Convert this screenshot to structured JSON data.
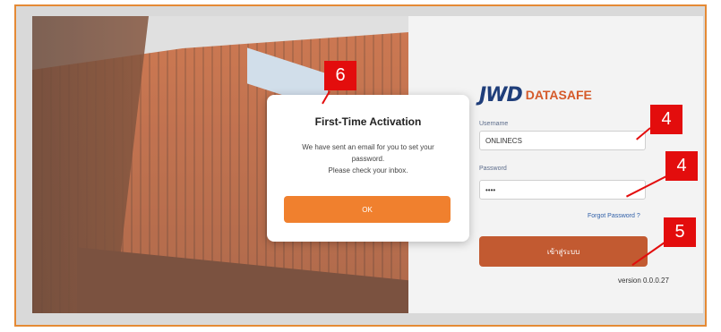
{
  "brand": {
    "mark": "JWD",
    "word": "DATASAFE"
  },
  "form": {
    "username_label": "Username",
    "username_value": "ONLINECS",
    "password_label": "Password",
    "password_value": "••••",
    "forgot_label": "Forgot Password ?",
    "login_label": "เข้าสู่ระบบ",
    "version": "version 0.0.0.27"
  },
  "modal": {
    "title": "First-Time Activation",
    "line1": "We have sent an email for you to set your",
    "line2": "password.",
    "line3": "Please check your inbox.",
    "ok_label": "OK"
  },
  "annotations": {
    "callout_6": "6",
    "callout_4a": "4",
    "callout_4b": "4",
    "callout_5": "5"
  },
  "colors": {
    "accent": "#f0802e",
    "login_button": "#c25a31",
    "callout": "#e30d0d",
    "frame": "#e58a35"
  }
}
